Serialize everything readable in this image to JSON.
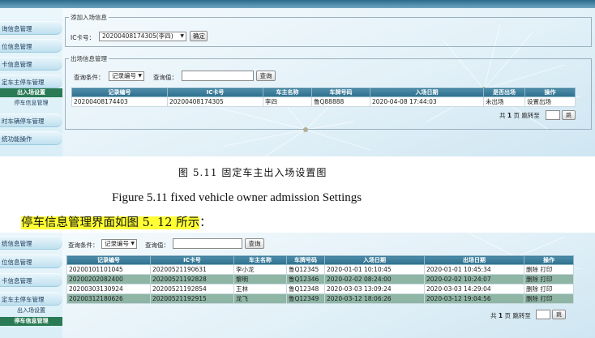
{
  "top_screen": {
    "sidebar": [
      {
        "label": "询信息管理"
      },
      {
        "label": "位信息管理"
      },
      {
        "label": "卡信息管理"
      },
      {
        "label": "定车主停车管理"
      }
    ],
    "sidebar_sub": [
      {
        "label": "出入场设置",
        "active": true
      },
      {
        "label": "停车信息管理",
        "active": false
      }
    ],
    "sidebar_tail": [
      {
        "label": "时车辆停车管理"
      },
      {
        "label": "统功能操作"
      }
    ],
    "entry_box": {
      "legend": "添加入场信息",
      "ic_label": "IC卡号：",
      "ic_selected": "20200408174305(李四)",
      "confirm_label": "确定"
    },
    "exit_box": {
      "legend": "出场信息管理",
      "query_cond_label": "查询条件：",
      "query_cond_selected": "记录编号",
      "query_value_label": "查询值：",
      "query_button": "查询",
      "columns": [
        "记录编号",
        "IC卡号",
        "车主名称",
        "车牌号码",
        "入场日期",
        "是否出场",
        "操作"
      ],
      "rows": [
        [
          "20200408174403",
          "20200408174305",
          "李四",
          "鲁Q88888",
          "2020-04-08 17:44:03",
          "未出场",
          "设置出场"
        ]
      ],
      "pager": {
        "prefix": "共",
        "count": "1",
        "suffix": "页 跳转至",
        "go": "跳"
      }
    }
  },
  "doc": {
    "caption_cn": "图 5.11 固定车主出入场设置图",
    "caption_en": "Figure 5.11 fixed vehicle owner admission Settings",
    "paragraph": "停车信息管理界面如图 5. 12 所示",
    "paragraph_tail": "："
  },
  "bottom_screen": {
    "sidebar": [
      {
        "label": "统信息管理"
      },
      {
        "label": "位信息管理"
      },
      {
        "label": "卡信息管理"
      },
      {
        "label": "定车主停车管理"
      }
    ],
    "sidebar_sub": [
      {
        "label": "出入场设置",
        "active": false
      },
      {
        "label": "停车信息管理",
        "active": true
      }
    ],
    "query_cond_label": "查询条件：",
    "query_cond_selected": "记录编号",
    "query_value_label": "查询值：",
    "query_button": "查询",
    "columns": [
      "记录编号",
      "IC卡号",
      "车主名称",
      "车牌号码",
      "入场日期",
      "出场日期",
      "操作"
    ],
    "rows": [
      {
        "cells": [
          "20200101101045",
          "20200521190631",
          "李小龙",
          "鲁Q12345",
          "2020-01-01 10:10:45",
          "2020-01-01 10:45:34"
        ],
        "delete": "删除",
        "print": "打印"
      },
      {
        "cells": [
          "20200202082400",
          "20200521192828",
          "黎明",
          "鲁Q12346",
          "2020-02-02 08:24:00",
          "2020-02-02 10:24:07"
        ],
        "delete": "删除",
        "print": "打印"
      },
      {
        "cells": [
          "20200303130924",
          "20200521192854",
          "王林",
          "鲁Q12348",
          "2020-03-03 13:09:24",
          "2020-03-03 14:29:04"
        ],
        "delete": "删除",
        "print": "打印"
      },
      {
        "cells": [
          "20200312180626",
          "20200521192915",
          "龙飞",
          "鲁Q12349",
          "2020-03-12 18:06:26",
          "2020-03-12 19:04:56"
        ],
        "delete": "删除",
        "print": "打印"
      }
    ],
    "pager": {
      "prefix": "共",
      "count": "1",
      "suffix": "页 跳转至",
      "go": "跳"
    }
  }
}
